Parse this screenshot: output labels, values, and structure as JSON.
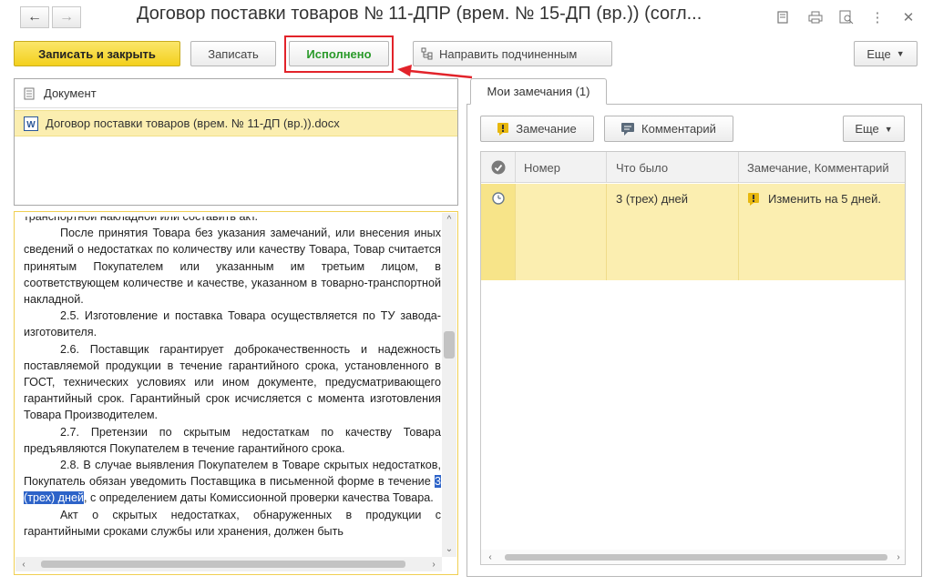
{
  "window": {
    "title": "Договор поставки товаров  № 11-ДПР (врем. № 15-ДП (вр.)) (согл..."
  },
  "toolbar": {
    "save_close": "Записать и закрыть",
    "save": "Записать",
    "done": "Исполнено",
    "send_sub": "Направить подчиненным",
    "more": "Еще"
  },
  "files": {
    "header": "Документ",
    "items": [
      {
        "name": "Договор поставки товаров (врем. № 11-ДП (вр.)).docx"
      }
    ]
  },
  "doc": {
    "paragraphs": [
      "транспортной накладной или составить акт.",
      "После принятия Товара без указания замечаний, или внесения иных сведений о недостатках по количеству или качеству Товара, Товар считается принятым Покупателем или указанным им третьим лицом, в соответствующем количестве и качестве, указанном в товарно-транспортной накладной.",
      "2.5. Изготовление и поставка Товара осуществляется по ТУ завода-изготовителя.",
      "2.6. Поставщик гарантирует доброкачественность и надежность поставляемой продукции в течение гарантийного срока, установленного в ГОСТ, технических условиях или ином документе, предусматривающего гарантийный срок. Гарантийный срок исчисляется с момента изготовления Товара Производителем.",
      "2.7. Претензии по скрытым недостаткам по качеству Товара предъявляются Покупателем в течение гарантийного срока."
    ],
    "p28_before": "2.8. В случае выявления Покупателем в Товаре скрытых недостатков, Покупатель обязан уведомить Поставщика в письменной форме в течение ",
    "p28_highlight": "3 (трех) дней",
    "p28_after": ", с определением даты Комиссионной проверки качества Товара.",
    "p29": "Акт о скрытых недостатках, обнаруженных в продукции с гарантийными сроками службы или хранения, должен быть"
  },
  "remarks": {
    "tab": "Мои замечания (1)",
    "add_remark": "Замечание",
    "add_comment": "Комментарий",
    "more": "Еще",
    "columns": [
      "Номер",
      "Что было",
      "Замечание, Комментарий"
    ],
    "rows": [
      {
        "number": "",
        "was": "3 (трех) дней",
        "remark": "Изменить на 5 дней."
      }
    ]
  },
  "colors": {
    "primary_yellow": "#f5d327",
    "done_green": "#2a9a2a",
    "annotation_red": "#e2232a",
    "selected_row": "#fbeeb0",
    "text_highlight": "#2d63c8"
  }
}
